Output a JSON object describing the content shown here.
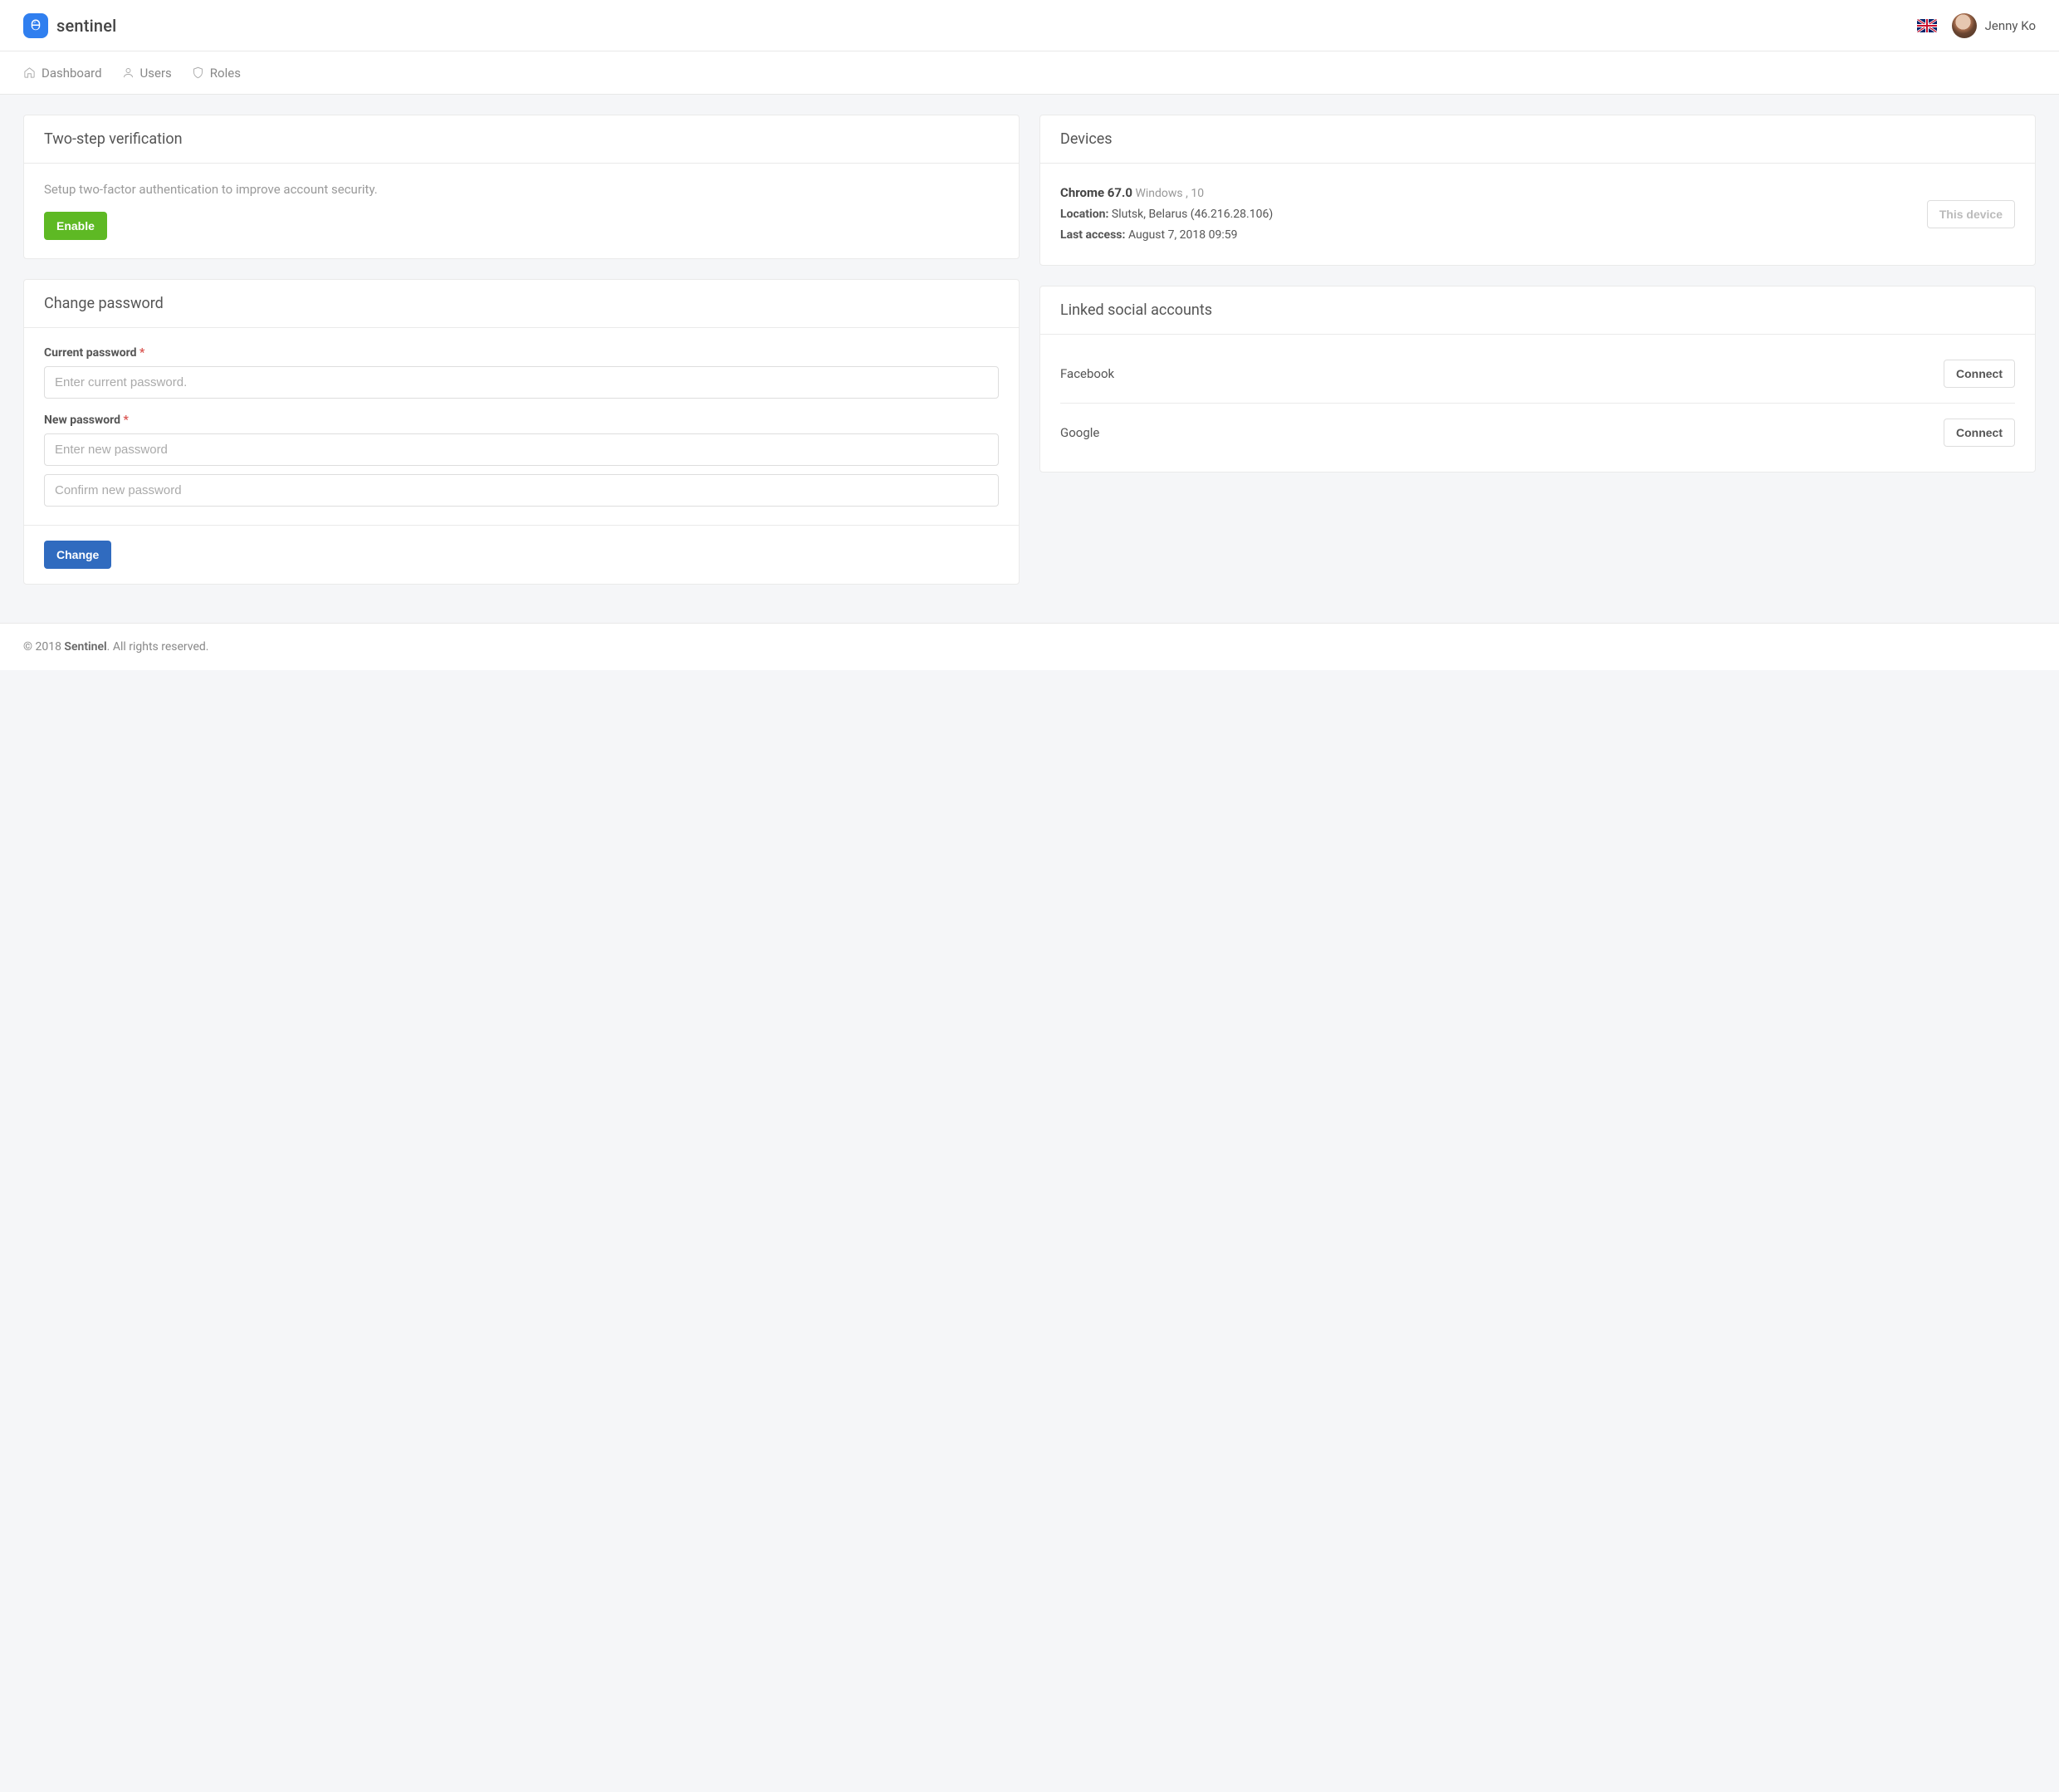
{
  "brand": {
    "name": "sentinel"
  },
  "user": {
    "name": "Jenny Ko"
  },
  "nav": {
    "dashboard": "Dashboard",
    "users": "Users",
    "roles": "Roles"
  },
  "two_step": {
    "title": "Two-step verification",
    "desc": "Setup two-factor authentication to improve account security.",
    "enable_btn": "Enable"
  },
  "change_pw": {
    "title": "Change password",
    "current_label": "Current password",
    "current_placeholder": "Enter current password.",
    "new_label": "New password",
    "new_placeholder": "Enter new password",
    "confirm_placeholder": "Confirm new password",
    "submit_btn": "Change",
    "required_mark": "*"
  },
  "devices": {
    "title": "Devices",
    "browser": "Chrome 67.0",
    "os": "Windows , 10",
    "location_label": "Location:",
    "location_value": "Slutsk, Belarus (46.216.28.106)",
    "last_access_label": "Last access:",
    "last_access_value": "August 7, 2018 09:59",
    "this_device_btn": "This device"
  },
  "social": {
    "title": "Linked social accounts",
    "providers": [
      {
        "name": "Facebook",
        "action": "Connect"
      },
      {
        "name": "Google",
        "action": "Connect"
      }
    ]
  },
  "footer": {
    "prefix": "© 2018 ",
    "brand": "Sentinel",
    "suffix": ". All rights reserved."
  }
}
